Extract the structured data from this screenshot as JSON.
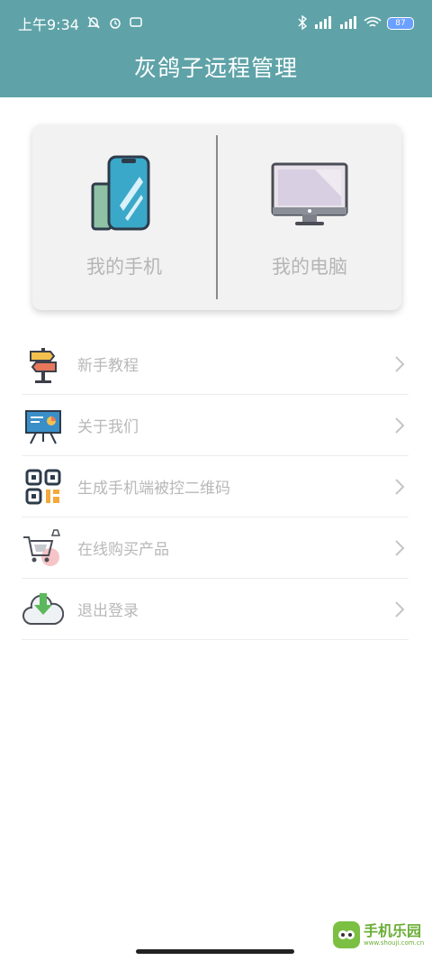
{
  "status_bar": {
    "time": "上午9:34",
    "battery": "87"
  },
  "header": {
    "title": "灰鸽子远程管理"
  },
  "devices": {
    "phone_label": "我的手机",
    "computer_label": "我的电脑"
  },
  "menu": {
    "items": [
      {
        "label": "新手教程",
        "icon": "signpost-icon"
      },
      {
        "label": "关于我们",
        "icon": "presentation-board-icon"
      },
      {
        "label": "生成手机端被控二维码",
        "icon": "qr-code-icon"
      },
      {
        "label": "在线购买产品",
        "icon": "shopping-cart-icon"
      },
      {
        "label": "退出登录",
        "icon": "cloud-download-icon"
      }
    ]
  },
  "watermark": {
    "title": "手机乐园",
    "url": "www.shouji.com.cn"
  },
  "colors": {
    "header_bg": "#5fa3a8",
    "card_bg": "#f2f2f2",
    "label_gray": "#b8b8b8"
  }
}
